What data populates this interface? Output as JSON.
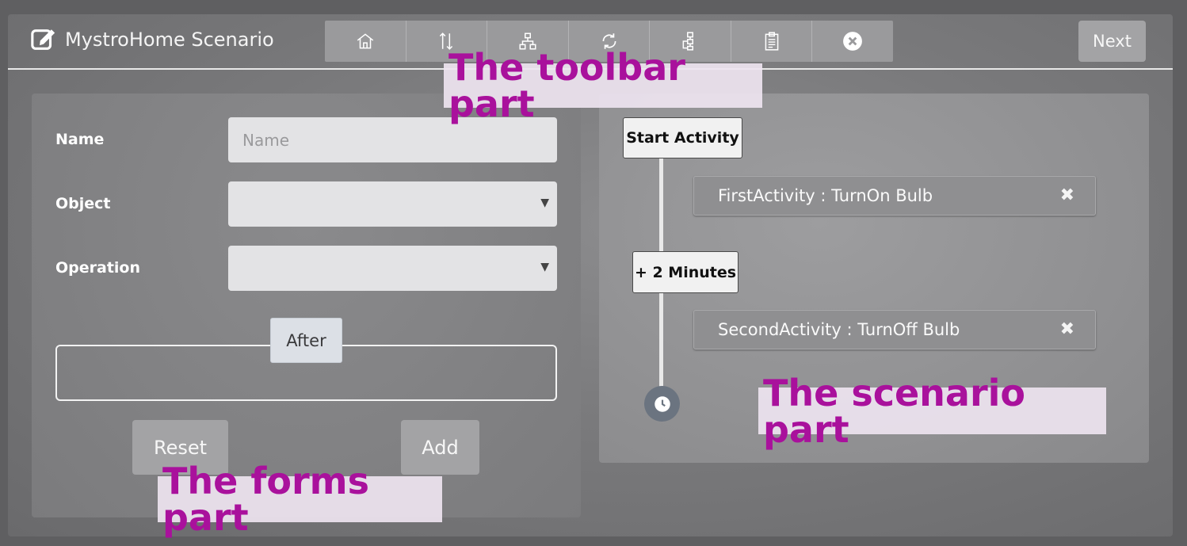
{
  "header": {
    "title": "MystroHome Scenario",
    "next_label": "Next"
  },
  "toolbar": {
    "items": [
      "house-icon",
      "sort-arrows-icon",
      "hierarchy-icon",
      "sync-icon",
      "flowchart-icon",
      "clipboard-icon",
      "close-circle-icon"
    ]
  },
  "form": {
    "name_label": "Name",
    "name_placeholder": "Name",
    "object_label": "Object",
    "object_value": "",
    "operation_label": "Operation",
    "operation_value": "",
    "after_label": "After",
    "reset_label": "Reset",
    "add_label": "Add"
  },
  "scenario": {
    "start_label": "Start Activity",
    "activities": [
      {
        "label": "FirstActivity : TurnOn Bulb",
        "remove": "✖"
      },
      {
        "label": "SecondActivity : TurnOff Bulb",
        "remove": "✖"
      }
    ],
    "delay_label": "+ 2 Minutes"
  },
  "annotations": {
    "toolbar": "The toolbar part",
    "scenario": "The scenario part",
    "forms": "The forms part"
  },
  "colors": {
    "accent_annotation": "#a9119c",
    "panel": "#7e7e80",
    "field": "#e3e3e5"
  }
}
